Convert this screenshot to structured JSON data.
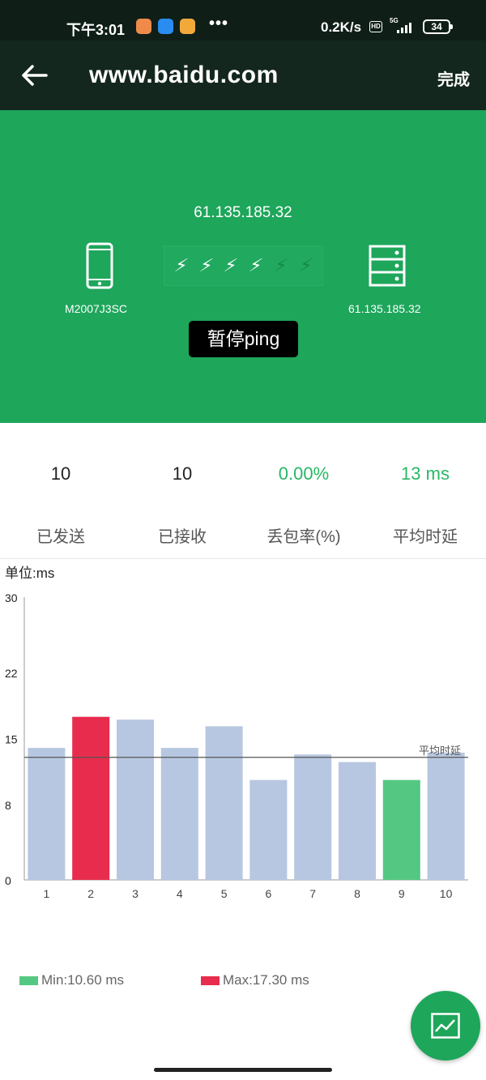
{
  "status_bar": {
    "time": "下午3:01",
    "dots": "•••",
    "net_speed": "0.2K/s",
    "hd": "HD",
    "network": "5G",
    "battery": "34",
    "app_icon_colors": [
      "#f08a4b",
      "#2a8cf0",
      "#f3a93a"
    ]
  },
  "title_bar": {
    "title": "www.baidu.com",
    "done_label": "完成"
  },
  "hero": {
    "target_ip": "61.135.185.32",
    "device_name": "M2007J3SC",
    "server_label": "61.135.185.32",
    "pause_label": "暂停ping",
    "packet_arrows": {
      "active": 4,
      "total": 6
    }
  },
  "stats": [
    {
      "value": "10",
      "label": "已发送",
      "color": "#222222"
    },
    {
      "value": "10",
      "label": "已接收",
      "color": "#222222"
    },
    {
      "value": "0.00%",
      "label": "丢包率(%)",
      "color": "#27b865"
    },
    {
      "value": "13 ms",
      "label": "平均时延",
      "color": "#27b865"
    }
  ],
  "unit_label": "单位:ms",
  "chart_data": {
    "type": "bar",
    "categories": [
      "1",
      "2",
      "3",
      "4",
      "5",
      "6",
      "7",
      "8",
      "9",
      "10"
    ],
    "values": [
      14.0,
      17.3,
      17.0,
      14.0,
      16.3,
      10.6,
      13.3,
      12.5,
      10.6,
      13.5
    ],
    "y_ticks": [
      "0",
      "8",
      "15",
      "22",
      "30"
    ],
    "ylim": [
      0,
      30
    ],
    "average": 13.0,
    "average_label": "平均时延",
    "colors": {
      "default": "#b7c7e1",
      "max": "#e82c4d",
      "min": "#54c882",
      "avg_line": "#555555"
    },
    "max_index": 1,
    "min_index": 8
  },
  "legend": {
    "min_label": "Min:10.60 ms",
    "max_label": "Max:17.30 ms",
    "min_color": "#54c882",
    "max_color": "#e82c4d"
  },
  "fab": {
    "icon": "chart-line-icon"
  }
}
